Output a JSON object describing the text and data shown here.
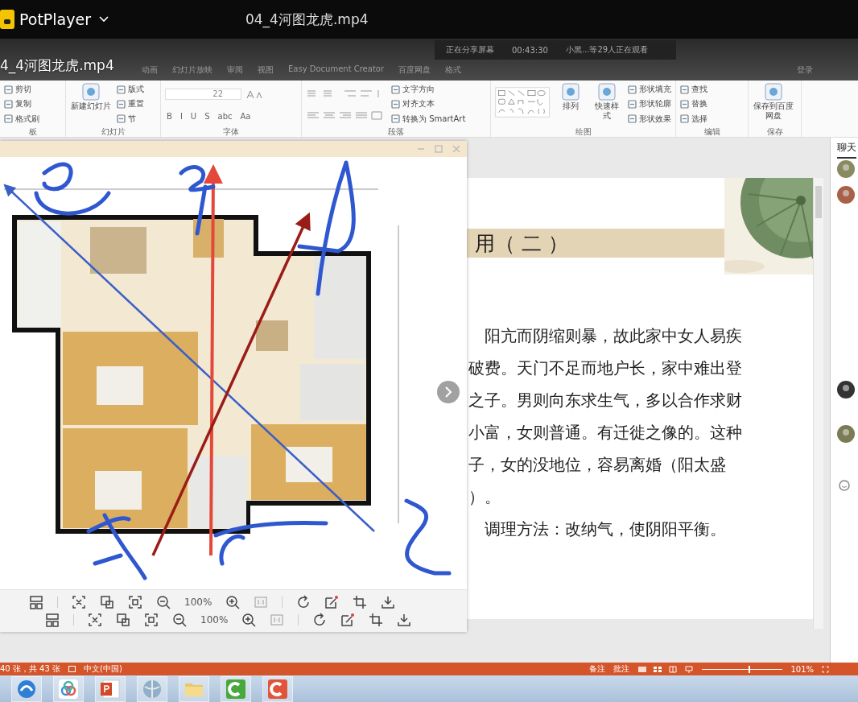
{
  "player": {
    "app_name": "PotPlayer",
    "file_title": "04_4河图龙虎.mp4",
    "osd_title": "4_4河图龙虎.mp4"
  },
  "meeting_bar": {
    "status": "正在分享屏幕",
    "time": "00:43:30",
    "viewers": "小黑...等29人正在观看"
  },
  "ribbon": {
    "tabs": [
      "动画",
      "幻灯片放映",
      "审阅",
      "视图",
      "Easy Document Creator",
      "百度网盘",
      "格式"
    ],
    "login": "登录",
    "groups": [
      {
        "kind": "clipboard",
        "label": "板",
        "items": [
          {
            "kind": "small",
            "text": "剪切"
          },
          {
            "kind": "small",
            "text": "复制"
          },
          {
            "kind": "small",
            "text": "格式刷"
          }
        ]
      },
      {
        "kind": "slides",
        "label": "幻灯片",
        "items": [
          {
            "kind": "large",
            "text": "新建幻灯片"
          },
          {
            "kind": "small",
            "text": "版式"
          },
          {
            "kind": "small",
            "text": "重置"
          },
          {
            "kind": "small",
            "text": "节"
          }
        ]
      },
      {
        "kind": "font",
        "label": "字体",
        "items": [
          {
            "kind": "field",
            "text": "22"
          },
          {
            "kind": "format",
            "text": "B"
          },
          {
            "kind": "format",
            "text": "I"
          },
          {
            "kind": "format",
            "text": "U"
          },
          {
            "kind": "format",
            "text": "S"
          },
          {
            "kind": "format",
            "text": "abc"
          },
          {
            "kind": "format",
            "text": "Aa"
          }
        ]
      },
      {
        "kind": "paragraph",
        "label": "段落",
        "items": [
          {
            "kind": "small",
            "text": "文字方向"
          },
          {
            "kind": "small",
            "text": "对齐文本"
          },
          {
            "kind": "small",
            "text": "转换为 SmartArt"
          }
        ]
      },
      {
        "kind": "drawing",
        "label": "绘图",
        "items": [
          {
            "kind": "large",
            "text": "排列"
          },
          {
            "kind": "large",
            "text": "快速样式"
          },
          {
            "kind": "small",
            "text": "形状填充"
          },
          {
            "kind": "small",
            "text": "形状轮廓"
          },
          {
            "kind": "small",
            "text": "形状效果"
          }
        ]
      },
      {
        "kind": "editing",
        "label": "编辑",
        "items": [
          {
            "kind": "small",
            "text": "查找"
          },
          {
            "kind": "small",
            "text": "替换"
          },
          {
            "kind": "small",
            "text": "选择"
          }
        ]
      },
      {
        "kind": "save",
        "label": "保存",
        "items": [
          {
            "kind": "large",
            "text": "保存到百度网盘"
          }
        ]
      }
    ]
  },
  "image_viewer": {
    "toolbars": [
      {
        "zoom": "100%"
      },
      {
        "zoom": "100%"
      }
    ]
  },
  "slide": {
    "title": "用（ 二 ）",
    "lines": [
      {
        "text": "阳亢而阴缩则暴，故此家中女人易疾",
        "indent": true
      },
      {
        "text": "破费。天门不足而地户长，家中难出登",
        "indent": false
      },
      {
        "text": "之子。男则向东求生气，多以合作求财",
        "indent": false
      },
      {
        "text": "小富，女则普通。有迁徙之像的。这种",
        "indent": false
      },
      {
        "text": "子，女的没地位，容易离婚（阳太盛",
        "indent": false
      },
      {
        "text": "）。",
        "indent": false
      },
      {
        "text": "调理方法：改纳气，使阴阳平衡。",
        "indent": true
      }
    ]
  },
  "chat": {
    "title": "聊天"
  },
  "status_bar": {
    "slide_count": "40 张，共 43 张",
    "language": "中文(中国)",
    "notes": "备注",
    "comments": "批注",
    "zoom": "101%",
    "level": 0.58
  }
}
